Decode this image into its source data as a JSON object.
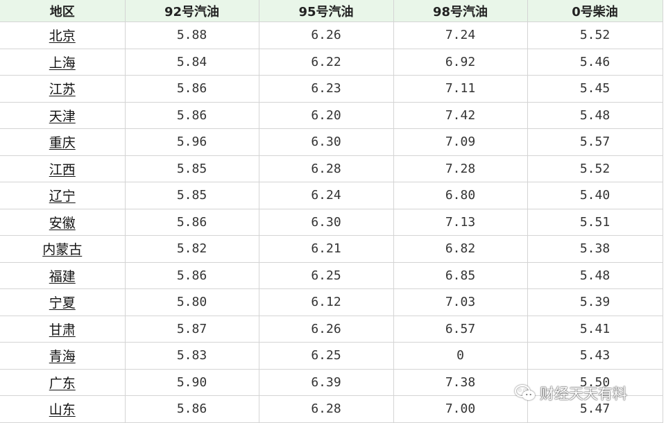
{
  "table": {
    "headers": [
      "地区",
      "92号汽油",
      "95号汽油",
      "98号汽油",
      "0号柴油"
    ],
    "rows": [
      [
        "北京",
        "5.88",
        "6.26",
        "7.24",
        "5.52"
      ],
      [
        "上海",
        "5.84",
        "6.22",
        "6.92",
        "5.46"
      ],
      [
        "江苏",
        "5.86",
        "6.23",
        "7.11",
        "5.45"
      ],
      [
        "天津",
        "5.86",
        "6.20",
        "7.42",
        "5.48"
      ],
      [
        "重庆",
        "5.96",
        "6.30",
        "7.09",
        "5.57"
      ],
      [
        "江西",
        "5.85",
        "6.28",
        "7.28",
        "5.52"
      ],
      [
        "辽宁",
        "5.85",
        "6.24",
        "6.80",
        "5.40"
      ],
      [
        "安徽",
        "5.86",
        "6.30",
        "7.13",
        "5.51"
      ],
      [
        "内蒙古",
        "5.82",
        "6.21",
        "6.82",
        "5.38"
      ],
      [
        "福建",
        "5.86",
        "6.25",
        "6.85",
        "5.48"
      ],
      [
        "宁夏",
        "5.80",
        "6.12",
        "7.03",
        "5.39"
      ],
      [
        "甘肃",
        "5.87",
        "6.26",
        "6.57",
        "5.41"
      ],
      [
        "青海",
        "5.83",
        "6.25",
        "0",
        "5.43"
      ],
      [
        "广东",
        "5.90",
        "6.39",
        "7.38",
        "5.50"
      ],
      [
        "山东",
        "5.86",
        "6.28",
        "7.00",
        "5.47"
      ]
    ]
  },
  "watermark": {
    "icon": "wechat-icon",
    "text": "财经天天有料"
  },
  "colors": {
    "header_bg": "#e9f6e9",
    "grid": "#d4d4d4"
  }
}
